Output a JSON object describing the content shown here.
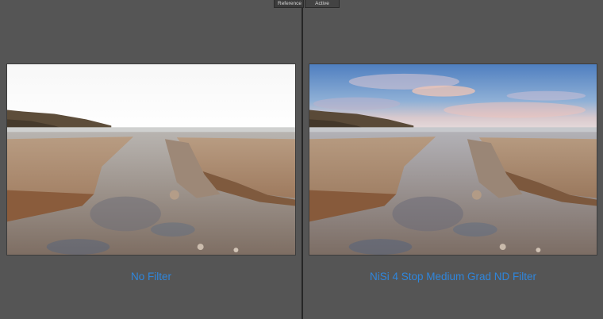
{
  "tabs": {
    "reference": "Reference",
    "active": "Active"
  },
  "captions": {
    "left": "No Filter",
    "right": "NiSi 4 Stop Medium Grad ND Filter"
  },
  "colors": {
    "background": "#555555",
    "caption": "#2f86dc"
  }
}
